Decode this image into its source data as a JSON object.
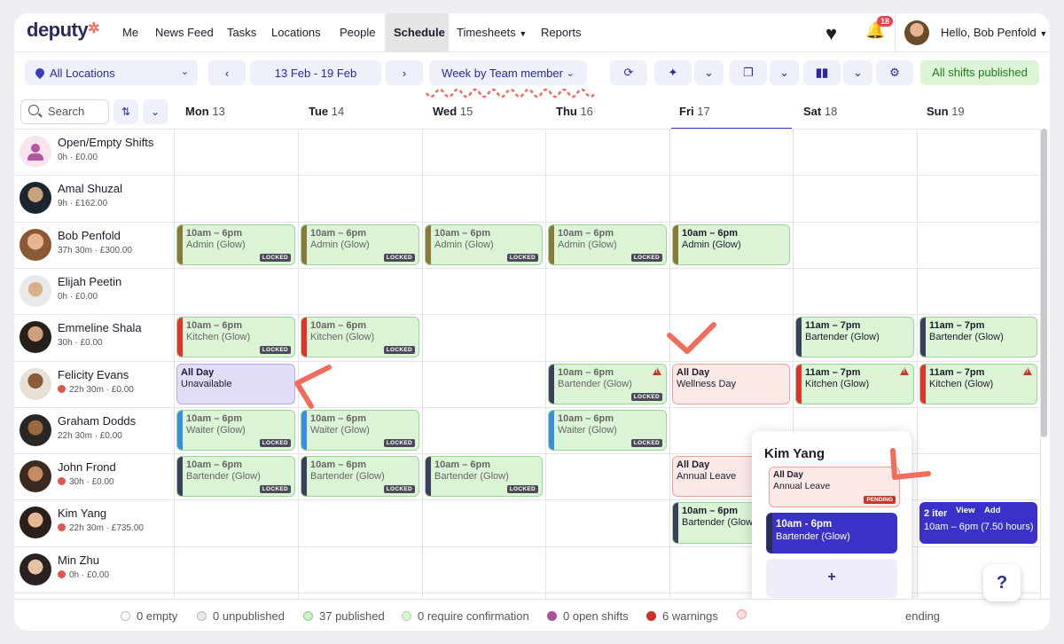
{
  "nav": {
    "logo": "deputy",
    "items": [
      "Me",
      "News Feed",
      "Tasks",
      "Locations",
      "People",
      "Schedule",
      "Timesheets",
      "Reports"
    ],
    "active": "Schedule",
    "notifications": "18",
    "greeting": "Hello, Bob Penfold"
  },
  "toolbar": {
    "location": "All Locations",
    "date_range": "13 Feb - 19 Feb",
    "view": "Week by Team member",
    "status": "All shifts published"
  },
  "search": {
    "placeholder": "Search"
  },
  "days": [
    {
      "name": "Mon",
      "num": "13"
    },
    {
      "name": "Tue",
      "num": "14"
    },
    {
      "name": "Wed",
      "num": "15"
    },
    {
      "name": "Thu",
      "num": "16"
    },
    {
      "name": "Fri",
      "num": "17"
    },
    {
      "name": "Sat",
      "num": "18"
    },
    {
      "name": "Sun",
      "num": "19"
    }
  ],
  "people": [
    {
      "name": "Open/Empty Shifts",
      "sub": "0h · £0.00",
      "warn": false
    },
    {
      "name": "Amal Shuzal",
      "sub": "9h · £162.00",
      "warn": false
    },
    {
      "name": "Bob Penfold",
      "sub": "37h 30m · £300.00",
      "warn": false
    },
    {
      "name": "Elijah Peetin",
      "sub": "0h · £0.00",
      "warn": false
    },
    {
      "name": "Emmeline Shala",
      "sub": "30h · £0.00",
      "warn": false
    },
    {
      "name": "Felicity Evans",
      "sub": "22h 30m · £0.00",
      "warn": true
    },
    {
      "name": "Graham Dodds",
      "sub": "22h 30m · £0.00",
      "warn": false
    },
    {
      "name": "John Frond",
      "sub": "30h · £0.00",
      "warn": true
    },
    {
      "name": "Kim Yang",
      "sub": "22h 30m · £735.00",
      "warn": true
    },
    {
      "name": "Min Zhu",
      "sub": "0h · £0.00",
      "warn": true
    }
  ],
  "shifts": [
    {
      "row": 2,
      "day": 0,
      "time": "10am – 6pm",
      "area": "Admin (Glow)",
      "bar": "#8a7a3a",
      "locked": true
    },
    {
      "row": 2,
      "day": 1,
      "time": "10am – 6pm",
      "area": "Admin (Glow)",
      "bar": "#8a7a3a",
      "locked": true
    },
    {
      "row": 2,
      "day": 2,
      "time": "10am – 6pm",
      "area": "Admin (Glow)",
      "bar": "#8a7a3a",
      "locked": true
    },
    {
      "row": 2,
      "day": 3,
      "time": "10am – 6pm",
      "area": "Admin (Glow)",
      "bar": "#8a7a3a",
      "locked": true
    },
    {
      "row": 2,
      "day": 4,
      "time": "10am – 6pm",
      "area": "Admin (Glow)",
      "bar": "#8a7a3a",
      "locked": false
    },
    {
      "row": 4,
      "day": 0,
      "time": "10am – 6pm",
      "area": "Kitchen (Glow)",
      "bar": "#e0332c",
      "locked": true
    },
    {
      "row": 4,
      "day": 1,
      "time": "10am – 6pm",
      "area": "Kitchen (Glow)",
      "bar": "#e0332c",
      "locked": true
    },
    {
      "row": 4,
      "day": 5,
      "time": "11am – 7pm",
      "area": "Bartender (Glow)",
      "bar": "#3b3f5c",
      "locked": false
    },
    {
      "row": 4,
      "day": 6,
      "time": "11am – 7pm",
      "area": "Bartender (Glow)",
      "bar": "#3b3f5c",
      "locked": false
    },
    {
      "row": 5,
      "day": 0,
      "time": "All Day",
      "area": "Unavailable",
      "bar": "",
      "locked": false,
      "kind": "unav"
    },
    {
      "row": 5,
      "day": 3,
      "time": "10am – 6pm",
      "area": "Bartender (Glow)",
      "bar": "#3b3f5c",
      "locked": true,
      "warn": true
    },
    {
      "row": 5,
      "day": 4,
      "time": "All Day",
      "area": "Wellness Day",
      "bar": "",
      "locked": false,
      "kind": "leave"
    },
    {
      "row": 5,
      "day": 5,
      "time": "11am – 7pm",
      "area": "Kitchen (Glow)",
      "bar": "#e0332c",
      "locked": false,
      "warn": true
    },
    {
      "row": 5,
      "day": 6,
      "time": "11am – 7pm",
      "area": "Kitchen (Glow)",
      "bar": "#e0332c",
      "locked": false,
      "warn": true
    },
    {
      "row": 6,
      "day": 0,
      "time": "10am – 6pm",
      "area": "Waiter (Glow)",
      "bar": "#3a8ee0",
      "locked": true
    },
    {
      "row": 6,
      "day": 1,
      "time": "10am – 6pm",
      "area": "Waiter (Glow)",
      "bar": "#3a8ee0",
      "locked": true
    },
    {
      "row": 6,
      "day": 3,
      "time": "10am – 6pm",
      "area": "Waiter (Glow)",
      "bar": "#3a8ee0",
      "locked": true
    },
    {
      "row": 7,
      "day": 0,
      "time": "10am – 6pm",
      "area": "Bartender (Glow)",
      "bar": "#3b3f5c",
      "locked": true
    },
    {
      "row": 7,
      "day": 1,
      "time": "10am – 6pm",
      "area": "Bartender (Glow)",
      "bar": "#3b3f5c",
      "locked": true
    },
    {
      "row": 7,
      "day": 2,
      "time": "10am – 6pm",
      "area": "Bartender (Glow)",
      "bar": "#3b3f5c",
      "locked": true
    },
    {
      "row": 7,
      "day": 4,
      "time": "All Day",
      "area": "Annual Leave",
      "bar": "",
      "locked": false,
      "kind": "leave"
    },
    {
      "row": 8,
      "day": 4,
      "time": "10am – 6pm",
      "area": "Bartender (Glow",
      "bar": "#3b3f5c",
      "locked": false
    },
    {
      "row": 8,
      "day": 6,
      "time": "2 iter",
      "area": "10am – 6pm (7.50 hours)",
      "bar": "",
      "locked": false,
      "kind": "blue"
    }
  ],
  "sun_overlay": {
    "view": "View",
    "add": "Add"
  },
  "popover": {
    "name": "Kim Yang",
    "leave_time": "All Day",
    "leave_type": "Annual Leave",
    "leave_status": "PENDING",
    "shift_time": "10am - 6pm",
    "shift_area": "Bartender (Glow)",
    "add_label": "+"
  },
  "lock_label": "LOCKED",
  "legend": [
    {
      "label": "0 empty",
      "color": "#ffffff"
    },
    {
      "label": "0 unpublished",
      "color": "#e8e8ea"
    },
    {
      "label": "37 published",
      "color": "#c9efc3"
    },
    {
      "label": "0 require confirmation",
      "color": "#dcf4d6"
    },
    {
      "label": "0 open shifts",
      "color": "#a8529a"
    },
    {
      "label": "6 warnings",
      "color": "#d0302a"
    },
    {
      "label": "",
      "color": "#fbe0de"
    }
  ],
  "legend_tail": "ending",
  "help": "?"
}
